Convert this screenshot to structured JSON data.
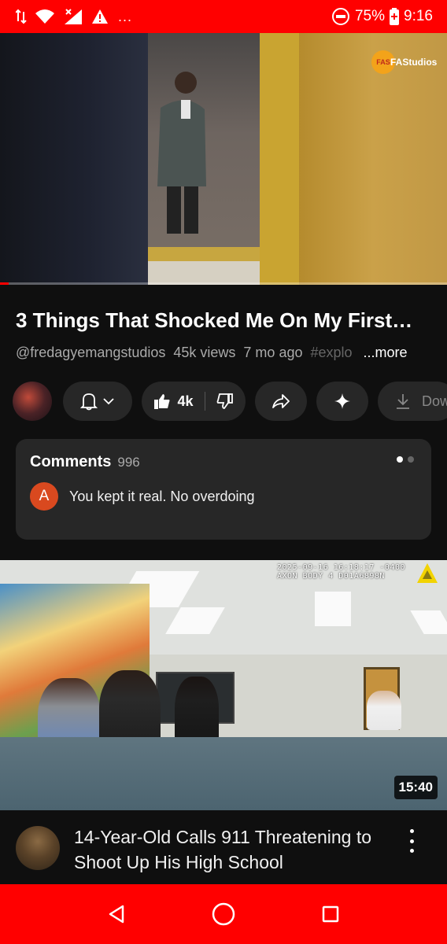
{
  "status_bar": {
    "battery": "75%",
    "time": "9:16",
    "overflow": "..."
  },
  "player": {
    "watermark": "FAStudios",
    "progress": 0.02
  },
  "video": {
    "title": "3 Things That Shocked Me On My First…",
    "channel_handle": "@fredagyemangstudios",
    "views": "45k views",
    "age": "7 mo ago",
    "hashtag": "#explo",
    "more_label": "...more"
  },
  "actions": {
    "likes": "4k",
    "download_label": "Dow"
  },
  "comments": {
    "label": "Comments",
    "count": "996",
    "first_avatar_letter": "A",
    "first_comment": "You kept it real. No overdoing"
  },
  "next_video": {
    "bodycam_line1": "2025-09-16 16:18:17 -0400",
    "bodycam_line2": "AXON BODY 4 D01A6898N",
    "duration": "15:40",
    "title": "14-Year-Old Calls 911 Threatening to Shoot Up His High School"
  },
  "colors": {
    "brand": "#ff0000",
    "background": "#0f0f0f",
    "pill": "#272727"
  },
  "icons": [
    "signal-icon",
    "wifi-icon",
    "alert-icon",
    "record-icon",
    "battery-icon",
    "bell-icon",
    "chevron-down-icon",
    "thumbs-up-icon",
    "thumbs-down-icon",
    "share-icon",
    "sparkle-icon",
    "download-icon",
    "kebab-icon",
    "back-icon",
    "home-icon",
    "recents-icon"
  ]
}
